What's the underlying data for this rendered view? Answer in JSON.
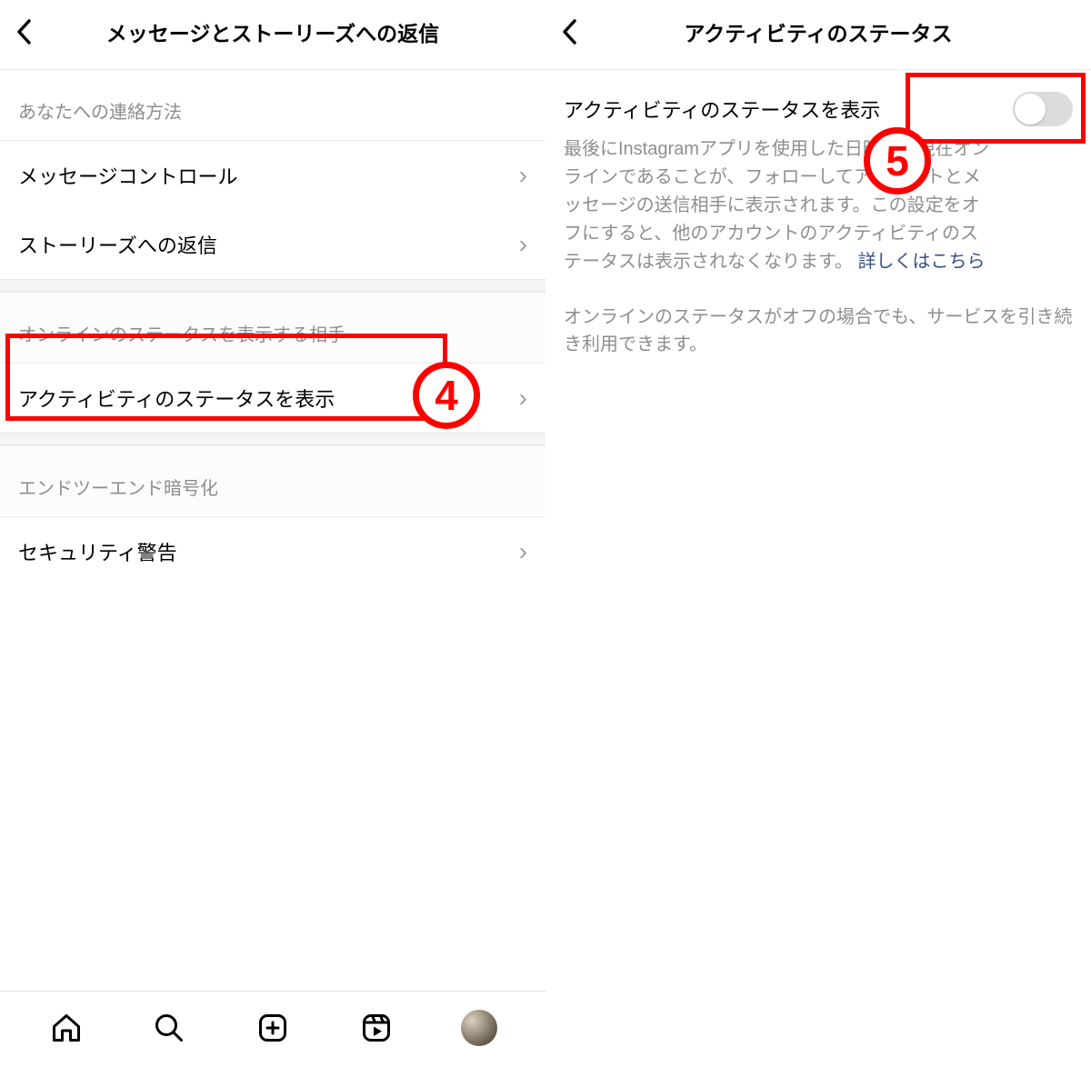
{
  "left": {
    "title": "メッセージとストーリーズへの返信",
    "sections": [
      {
        "header": "あなたへの連絡方法",
        "rows": [
          "メッセージコントロール",
          "ストーリーズへの返信"
        ]
      },
      {
        "header": "オンラインのステータスを表示する相手",
        "rows": [
          "アクティビティのステータスを表示"
        ]
      },
      {
        "header": "エンドツーエンド暗号化",
        "rows": [
          "セキュリティ警告"
        ]
      }
    ]
  },
  "right": {
    "title": "アクティビティのステータス",
    "toggle_label": "アクティビティのステータスを表示",
    "toggle_on": false,
    "desc_pre": "最後にInstagramアプリを使用した日時や、現在オンラインであることが、フォローしてアカウントとメッセージの送信相手に表示されます。この設定をオフにすると、他のアカウントのアクティビティのステータスは表示されなくなります。 ",
    "desc_link": "詳しくはこちら",
    "note": "オンラインのステータスがオフの場合でも、サービスを引き続き利用できます。"
  },
  "annotations": {
    "badge4": "4",
    "badge5": "5"
  }
}
